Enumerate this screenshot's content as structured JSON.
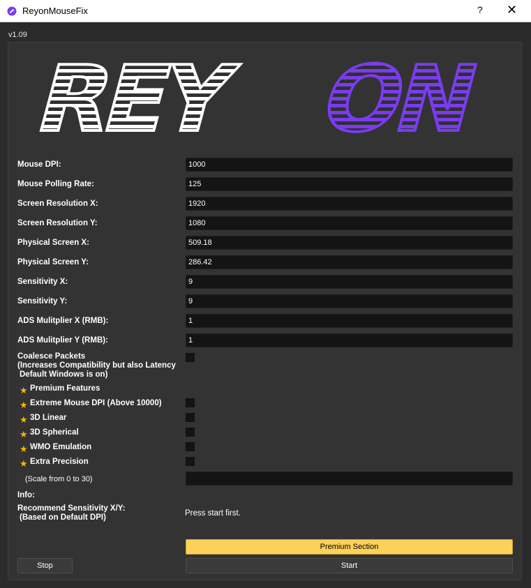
{
  "window": {
    "title": "ReyonMouseFix",
    "help_label": "?",
    "close_label": "✕",
    "version": "v1.09"
  },
  "logo": {
    "text_white": "REY",
    "text_purple": "ON",
    "purple": "#7b3cf0"
  },
  "fields": [
    {
      "label": "Mouse DPI:",
      "value": "1000"
    },
    {
      "label": "Mouse Polling Rate:",
      "value": "125"
    },
    {
      "label": "Screen Resolution X:",
      "value": "1920"
    },
    {
      "label": "Screen Resolution Y:",
      "value": "1080"
    },
    {
      "label": "Physical Screen X:",
      "value": "509.18"
    },
    {
      "label": "Physical Screen Y:",
      "value": "286.42"
    },
    {
      "label": "Sensitivity X:",
      "value": "9"
    },
    {
      "label": "Sensitivity Y:",
      "value": "9"
    },
    {
      "label": "ADS Mulitplier X (RMB):",
      "value": "1"
    },
    {
      "label": "ADS Mulitplier Y (RMB):",
      "value": "1"
    }
  ],
  "coalesce": {
    "line1": "Coalesce Packets",
    "line2": "(Increases Compatibility but also Latency",
    "line3": "Default Windows is on)",
    "checked": false
  },
  "premium": {
    "header": "Premium Features",
    "options": [
      {
        "label": "Extreme Mouse DPI (Above 10000)",
        "checked": false
      },
      {
        "label": "3D Linear",
        "checked": false
      },
      {
        "label": "3D Spherical",
        "checked": false
      },
      {
        "label": "WMO Emulation",
        "checked": false
      },
      {
        "label": "Extra Precision",
        "checked": false
      }
    ],
    "scale_label": "(Scale from 0 to 30)",
    "scale_value": ""
  },
  "info": {
    "label": "Info:",
    "recommend_line1": "Recommend Sensitivity X/Y:",
    "recommend_line2": "(Based on Default DPI)",
    "result": "Press start first."
  },
  "buttons": {
    "premium_section": "Premium Section",
    "stop": "Stop",
    "start": "Start"
  },
  "colors": {
    "accent_yellow": "#fbd15a",
    "star": "#f5b800",
    "purple": "#7b3cf0",
    "background": "#2b2b2b",
    "panel": "#333333"
  }
}
